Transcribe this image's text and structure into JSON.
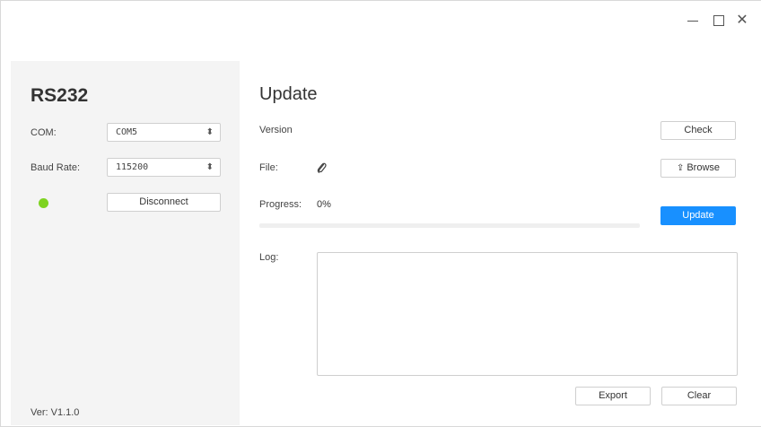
{
  "left": {
    "title": "RS232",
    "com_label": "COM:",
    "com_value": "COM5",
    "baud_label": "Baud Rate:",
    "baud_value": "115200",
    "connection_status": "connected",
    "status_color": "#7ed321",
    "disconnect_label": "Disconnect",
    "version": "Ver: V1.1.0"
  },
  "update": {
    "title": "Update",
    "version_label": "Version",
    "check_label": "Check",
    "file_label": "File:",
    "file_icon": "paperclip-icon",
    "browse_icon": "upload-icon",
    "browse_label": "Browse",
    "progress_label": "Progress:",
    "progress_value": "0%",
    "progress_fraction": 0,
    "update_label": "Update",
    "log_label": "Log:",
    "log_content": "",
    "export_label": "Export",
    "clear_label": "Clear",
    "accent_color": "#1890ff"
  }
}
